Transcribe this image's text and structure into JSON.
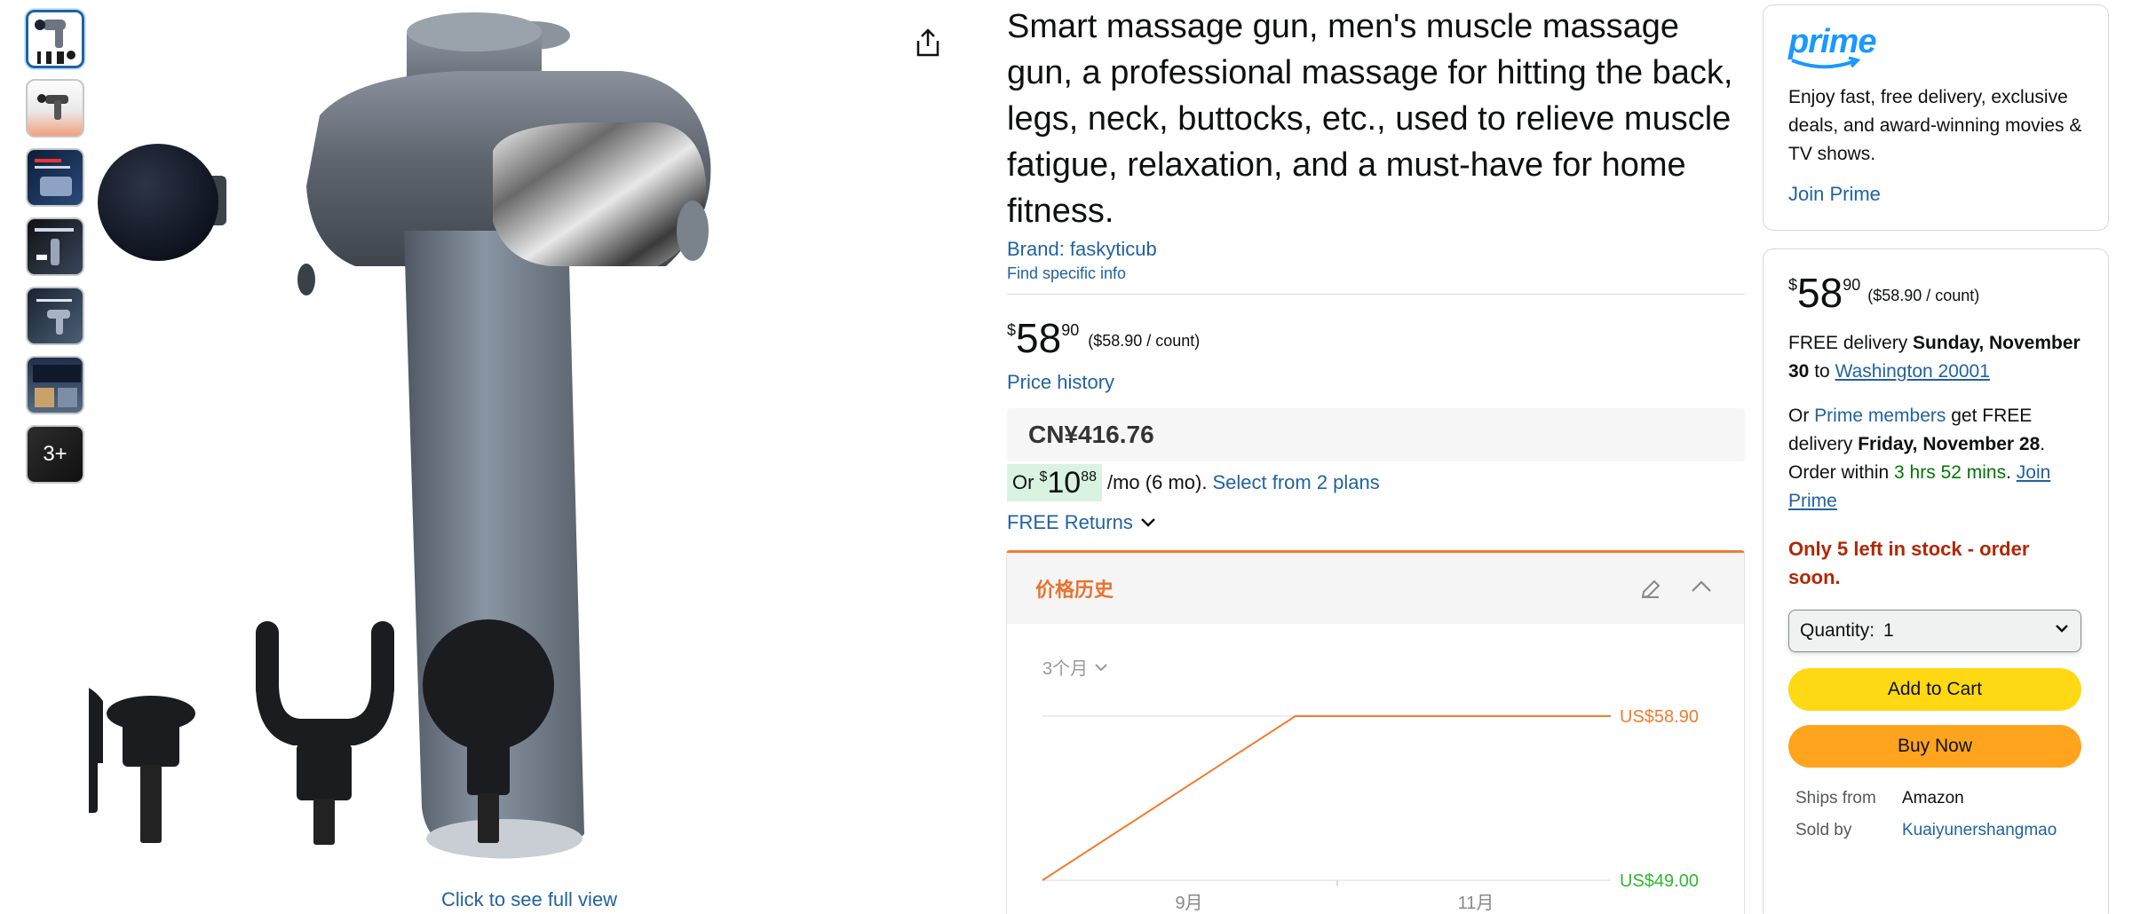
{
  "gallery": {
    "thumbnails": [
      "thumb-1",
      "thumb-2",
      "thumb-3",
      "thumb-4",
      "thumb-5",
      "thumb-6",
      "thumb-7"
    ],
    "more_label": "3+",
    "see_full_view": "Click to see full view"
  },
  "product": {
    "title": "Smart massage gun, men's muscle massage gun, a professional massage for hitting the back, legs, neck, buttocks, etc., used to relieve muscle fatigue, relaxation, and a must-have for home fitness.",
    "brand": "Brand: faskyticub",
    "find_info": "Find specific info",
    "price_symbol": "$",
    "price_whole": "58",
    "price_fraction": "90",
    "price_per_unit": "($58.90 / count)",
    "price_history_link": "Price history",
    "converted_price": "CN¥416.76",
    "installment_prefix": "Or",
    "installment_symbol": "$",
    "installment_whole": "10",
    "installment_fraction": "88",
    "installment_term": "/mo (6 mo).",
    "installment_link": "Select from 2 plans",
    "returns": "FREE Returns"
  },
  "price_history": {
    "title": "价格历史",
    "range_label": "3个月",
    "accent_color": "#f07c2e"
  },
  "chart_data": {
    "type": "line",
    "x_tick_labels": [
      "9月",
      "11月"
    ],
    "series": [
      {
        "values": [
          49.0,
          58.9,
          58.9
        ]
      }
    ],
    "ylim": [
      49.0,
      58.9
    ],
    "y_labels": {
      "max": "US$58.90",
      "min": "US$49.00"
    },
    "line_color": "#f07c2e",
    "max_label_color": "#f07c2e",
    "min_label_color": "#2eb82e"
  },
  "prime_box": {
    "logo": "prime",
    "text": "Enjoy fast, free delivery, exclusive deals, and award-winning movies & TV shows.",
    "join": "Join Prime"
  },
  "buy_box": {
    "price_symbol": "$",
    "price_whole": "58",
    "price_fraction": "90",
    "price_per_unit": "($58.90 / count)",
    "delivery_prefix": "FREE delivery",
    "delivery_date": "Sunday, November 30",
    "delivery_to": "to",
    "delivery_location": "Washington 20001",
    "or_text": "Or",
    "prime_members": "Prime members",
    "get_free": "get FREE delivery",
    "fast_date": "Friday, November 28",
    "order_within": "Order within",
    "countdown": "3 hrs 52 mins",
    "join_prime": "Join Prime",
    "stock": "Only 5 left in stock - order soon.",
    "quantity_label": "Quantity:",
    "quantity_value": "1",
    "add_to_cart": "Add to Cart",
    "buy_now": "Buy Now",
    "ships_from_label": "Ships from",
    "ships_from_value": "Amazon",
    "sold_by_label": "Sold by",
    "sold_by_value": "Kuaiyunershangmao"
  },
  "colors": {
    "link": "#2162a1",
    "add_to_cart": "#ffd814",
    "buy_now": "#ffa41c",
    "stock_warning": "#b12704",
    "prime_blue": "#1a98ff"
  }
}
